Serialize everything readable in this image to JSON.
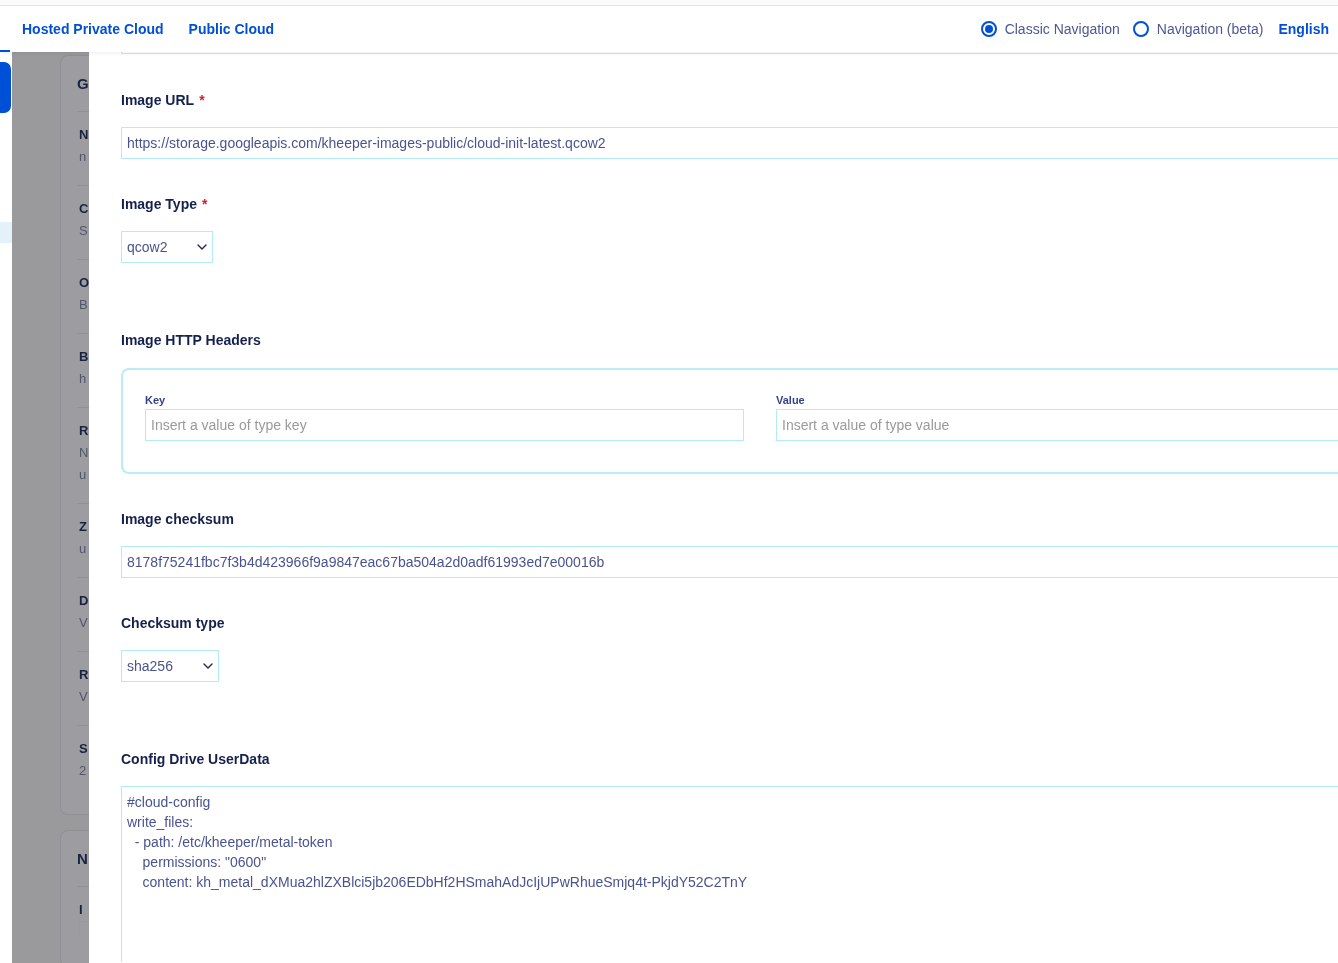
{
  "top_nav": {
    "links": [
      {
        "label": "Hosted Private Cloud"
      },
      {
        "label": "Public Cloud"
      }
    ],
    "navigation_options": [
      {
        "label": "Classic Navigation",
        "selected": true
      },
      {
        "label": "Navigation (beta)",
        "selected": false
      }
    ],
    "language": "English"
  },
  "background_cards": [
    {
      "title": "G",
      "rows": [
        {
          "kind": "text",
          "label": "N",
          "lines": [
            "n"
          ]
        },
        {
          "kind": "text",
          "label": "C",
          "lines": [
            "S"
          ]
        },
        {
          "kind": "text",
          "label": "O",
          "lines": [
            "B"
          ]
        },
        {
          "kind": "text",
          "label": "B",
          "lines": [
            "h"
          ]
        },
        {
          "kind": "text",
          "label": "R",
          "lines": [
            "N",
            "u"
          ]
        },
        {
          "kind": "text",
          "label": "Z",
          "lines": [
            "u"
          ]
        },
        {
          "kind": "text",
          "label": "D",
          "lines": [
            "V"
          ]
        },
        {
          "kind": "text",
          "label": "R",
          "lines": [
            "V"
          ]
        },
        {
          "kind": "text",
          "label": "S",
          "lines": [
            "2"
          ]
        }
      ]
    },
    {
      "title": "N",
      "rows": [
        {
          "kind": "field",
          "label": "I"
        }
      ]
    }
  ],
  "drawer": {
    "partial_field_above": true,
    "fields": [
      {
        "kind": "text",
        "label": "Image URL",
        "required_mark": "*",
        "value": "https://storage.googleapis.com/kheeper-images-public/cloud-init-latest.qcow2"
      },
      {
        "kind": "select",
        "label": "Image Type",
        "required_mark": "*",
        "value": "qcow2"
      },
      {
        "kind": "key_value",
        "label": "Image HTTP Headers",
        "columns": [
          {
            "label": "Key",
            "placeholder": "Insert a value of type key"
          },
          {
            "label": "Value",
            "placeholder": "Insert a value of type value"
          }
        ]
      },
      {
        "kind": "text",
        "label": "Image checksum",
        "value": "8178f75241fbc7f3b4d423966f9a9847eac67ba504a2d0adf61993ed7e00016b"
      },
      {
        "kind": "select",
        "label": "Checksum type",
        "value": "sha256"
      },
      {
        "kind": "textarea",
        "label": "Config Drive UserData",
        "value": "#cloud-config\nwrite_files:\n  - path: /etc/kheeper/metal-token\n    permissions: \"0600\"\n    content: kh_metal_dXMua2hlZXBlci5jb206EDbHf2HSmahAdJcIjUPwRhueSmjq4t-PkjdY52C2TnY"
      }
    ]
  }
}
